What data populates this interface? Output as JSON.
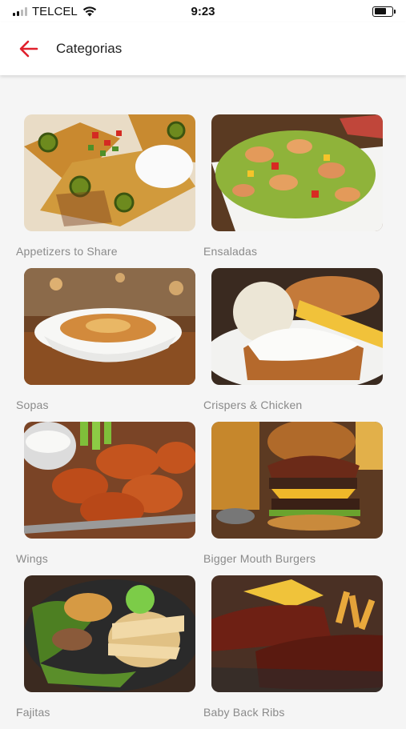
{
  "status": {
    "carrier": "TELCEL",
    "time": "9:23"
  },
  "header": {
    "back_icon": "arrow-left-icon",
    "title": "Categorias",
    "accent": "#e0202c"
  },
  "categories": [
    {
      "label": "Appetizers to Share"
    },
    {
      "label": "Ensaladas"
    },
    {
      "label": "Sopas"
    },
    {
      "label": "Crispers & Chicken"
    },
    {
      "label": "Wings"
    },
    {
      "label": "Bigger Mouth Burgers"
    },
    {
      "label": "Fajitas"
    },
    {
      "label": "Baby Back Ribs"
    }
  ]
}
